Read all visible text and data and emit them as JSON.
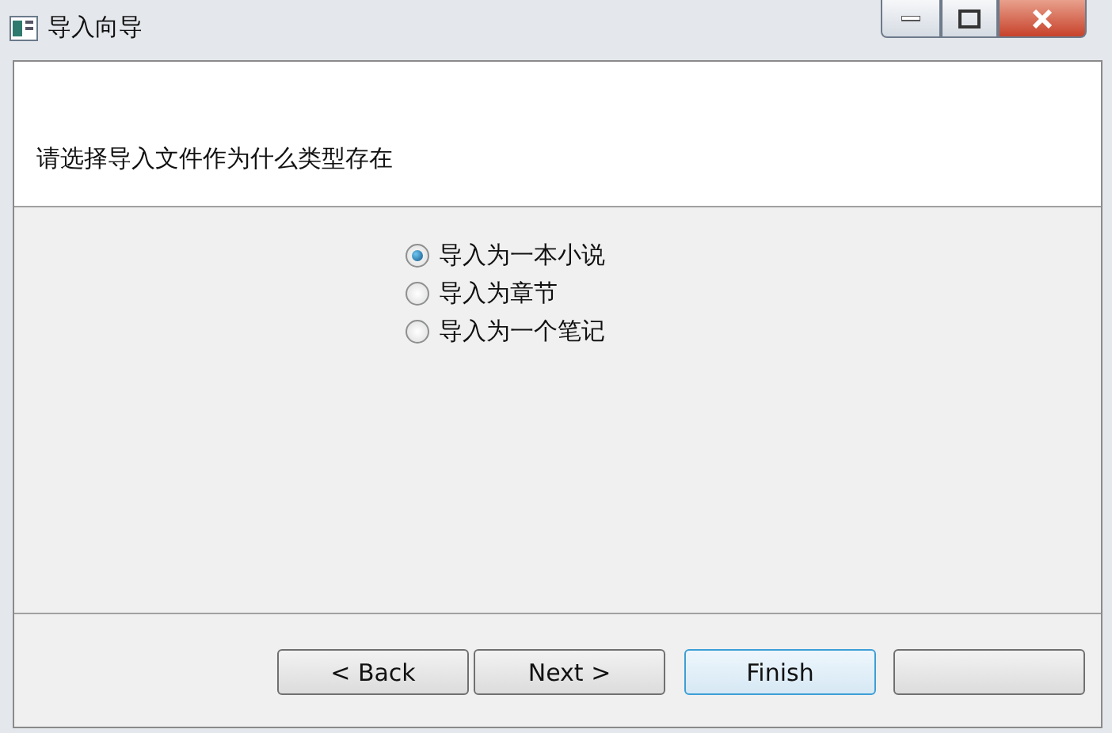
{
  "window": {
    "title": "导入向导"
  },
  "header": {
    "prompt": "请选择导入文件作为什么类型存在"
  },
  "options": [
    {
      "label": "导入为一本小说",
      "selected": true
    },
    {
      "label": "导入为章节",
      "selected": false
    },
    {
      "label": "导入为一个笔记",
      "selected": false
    }
  ],
  "buttons": [
    {
      "label": "< Back",
      "default": false
    },
    {
      "label": "Next >",
      "default": false
    },
    {
      "label": "Finish",
      "default": true
    },
    {
      "default": false
    }
  ]
}
